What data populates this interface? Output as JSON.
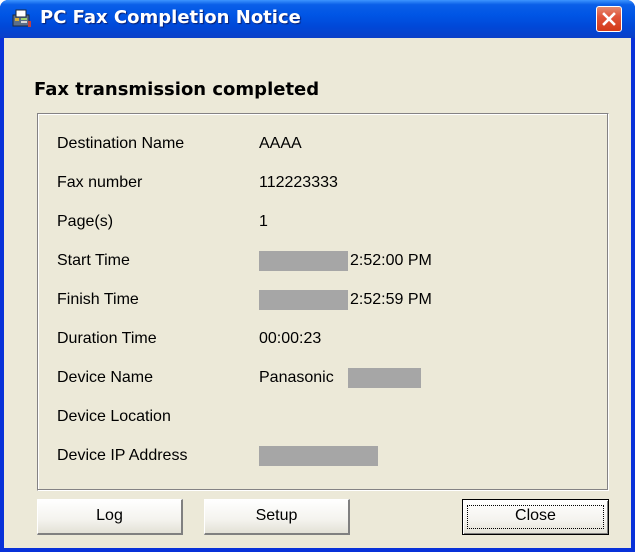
{
  "window": {
    "title": "PC Fax Completion Notice",
    "icon": "fax-app-icon"
  },
  "heading": "Fax transmission completed",
  "details": [
    {
      "label": "Destination Name",
      "value": "AAAA"
    },
    {
      "label": "Fax number",
      "value": "112223333"
    },
    {
      "label": "Page(s)",
      "value": "1"
    },
    {
      "label": "Start Time",
      "value": "2:52:00 PM",
      "redacted_prefix": true
    },
    {
      "label": "Finish Time",
      "value": "2:52:59 PM",
      "redacted_prefix": true
    },
    {
      "label": "Duration Time",
      "value": "00:00:23"
    },
    {
      "label": "Device Name",
      "value": "Panasonic",
      "redacted_suffix": true
    },
    {
      "label": "Device Location",
      "value": ""
    },
    {
      "label": "Device IP Address",
      "value": "",
      "redacted": true
    }
  ],
  "buttons": {
    "log": "Log",
    "setup": "Setup",
    "close": "Close"
  },
  "colors": {
    "titlebar": "#0055e5",
    "dialog_bg": "#ece9d8",
    "close_button": "#e0543a",
    "redaction": "#a6a6a6"
  }
}
